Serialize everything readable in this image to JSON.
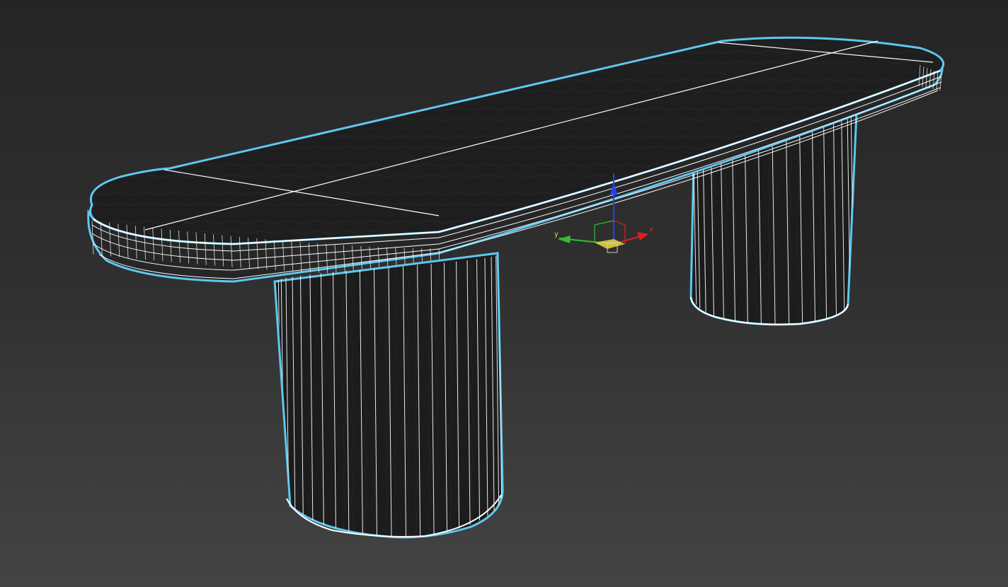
{
  "viewport": {
    "background_top": "#252525",
    "background_bottom": "#444444"
  },
  "model": {
    "name": "bench-table",
    "surface_color": "#1f1f1f",
    "wire_color": "#ffffff",
    "selection_outline_color": "#5ec8f0"
  },
  "gizmo": {
    "x_label": "x",
    "y_label": "y",
    "x_color": "#e02020",
    "y_color": "#30c030",
    "z_color": "#2040ff",
    "plane_color": "#e8d840"
  }
}
